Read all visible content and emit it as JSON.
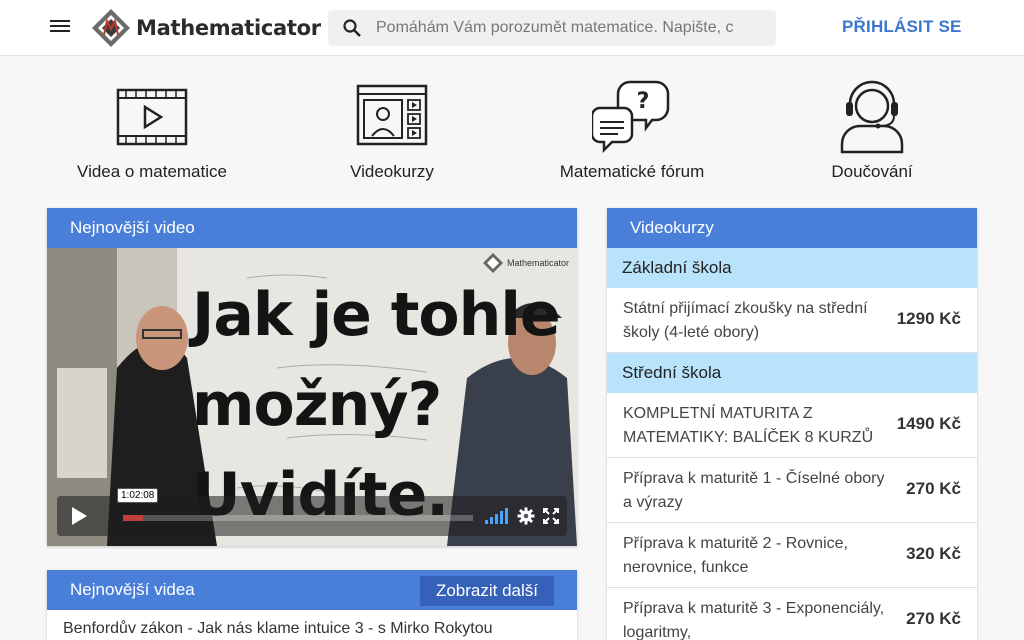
{
  "header": {
    "logo_text": "Mathematicator",
    "search_placeholder": "Pomáhám Vám porozumět matematice. Napište, c",
    "login_label": "PŘIHLÁSIT SE"
  },
  "nav": {
    "items": [
      {
        "label": "Videa o matematice",
        "icon": "video-icon"
      },
      {
        "label": "Videokurzy",
        "icon": "video-course-icon"
      },
      {
        "label": "Matematické fórum",
        "icon": "forum-icon"
      },
      {
        "label": "Doučování",
        "icon": "headset-icon"
      }
    ]
  },
  "newest_video": {
    "title": "Nejnovější video",
    "thumbnail_text": [
      "Jak je tohle",
      "možný?",
      "Uvidíte."
    ],
    "watermark": "Mathematicator",
    "time_tooltip": "1:02:08"
  },
  "latest_videos": {
    "title": "Nejnovější videa",
    "show_more_label": "Zobrazit další",
    "items": [
      "Benfordův zákon - Jak nás klame intuice 3 - s Mirko Rokytou"
    ]
  },
  "courses": {
    "title": "Videokurzy",
    "categories": [
      {
        "name": "Základní škola",
        "items": [
          {
            "title": "Státní přijímací zkoušky na střední školy (4-leté obory)",
            "price": "1290 Kč"
          }
        ]
      },
      {
        "name": "Střední škola",
        "items": [
          {
            "title": "KOMPLETNÍ MATURITA Z MATEMATIKY: BALÍČEK 8 KURZŮ",
            "price": "1490 Kč"
          },
          {
            "title": "Příprava k maturitě 1 - Číselné obory a výrazy",
            "price": "270 Kč"
          },
          {
            "title": "Příprava k maturitě 2 - Rovnice, nerovnice, funkce",
            "price": "320 Kč"
          },
          {
            "title": "Příprava k maturitě 3 - Exponenciály, logaritmy,",
            "price": "270 Kč"
          }
        ]
      }
    ]
  },
  "colors": {
    "brand_blue": "#4a7fd9",
    "category_bg": "#b9e3fb",
    "login_text": "#3a78d0"
  }
}
